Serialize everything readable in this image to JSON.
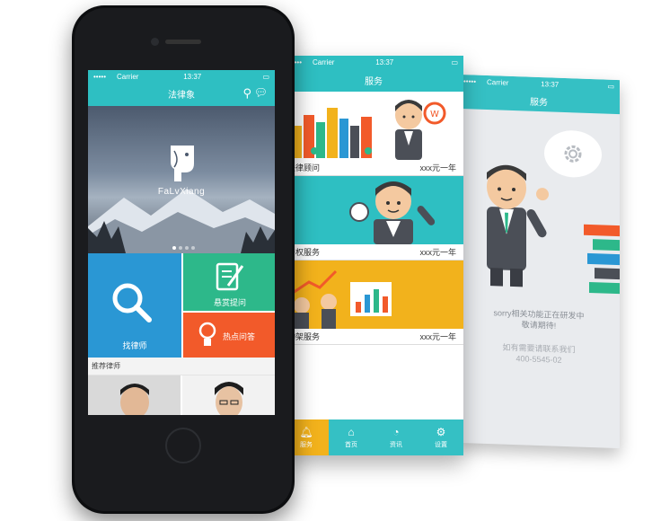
{
  "colors": {
    "teal": "#2ebfc2",
    "blue": "#2a97d4",
    "green": "#2db88a",
    "orange": "#f25a2a",
    "yellow": "#f2b21c"
  },
  "phone1": {
    "status": {
      "carrier": "Carrier",
      "time": "13:37"
    },
    "title": "法律象",
    "brand": "FaLvXiang",
    "tiles": {
      "find_lawyer": "找律师",
      "reward_question": "悬赏提问",
      "hot_question": "热点问答"
    },
    "recommend_title": "推荐律师"
  },
  "phone2": {
    "status": {
      "carrier": "Carrier",
      "time": "13:37"
    },
    "title": "服务",
    "services": [
      {
        "name": "法律顾问",
        "price": "xxx元一年"
      },
      {
        "name": "产权服务",
        "price": "xxx元一年"
      },
      {
        "name": "构架服务",
        "price": "xxx元一年"
      }
    ],
    "tabs": [
      {
        "label": "服务",
        "icon": "bell-icon"
      },
      {
        "label": "首页",
        "icon": "home-icon"
      },
      {
        "label": "资讯",
        "icon": "news-icon"
      },
      {
        "label": "设置",
        "icon": "gear-icon"
      }
    ]
  },
  "phone3": {
    "status": {
      "carrier": "Carrier",
      "time": "13:37"
    },
    "title": "服务",
    "message_line1": "sorry相关功能正在研发中",
    "message_line2": "敬请期待!",
    "contact_line1": "如有需要请联系我们",
    "contact_line2": "400-5545-02"
  }
}
